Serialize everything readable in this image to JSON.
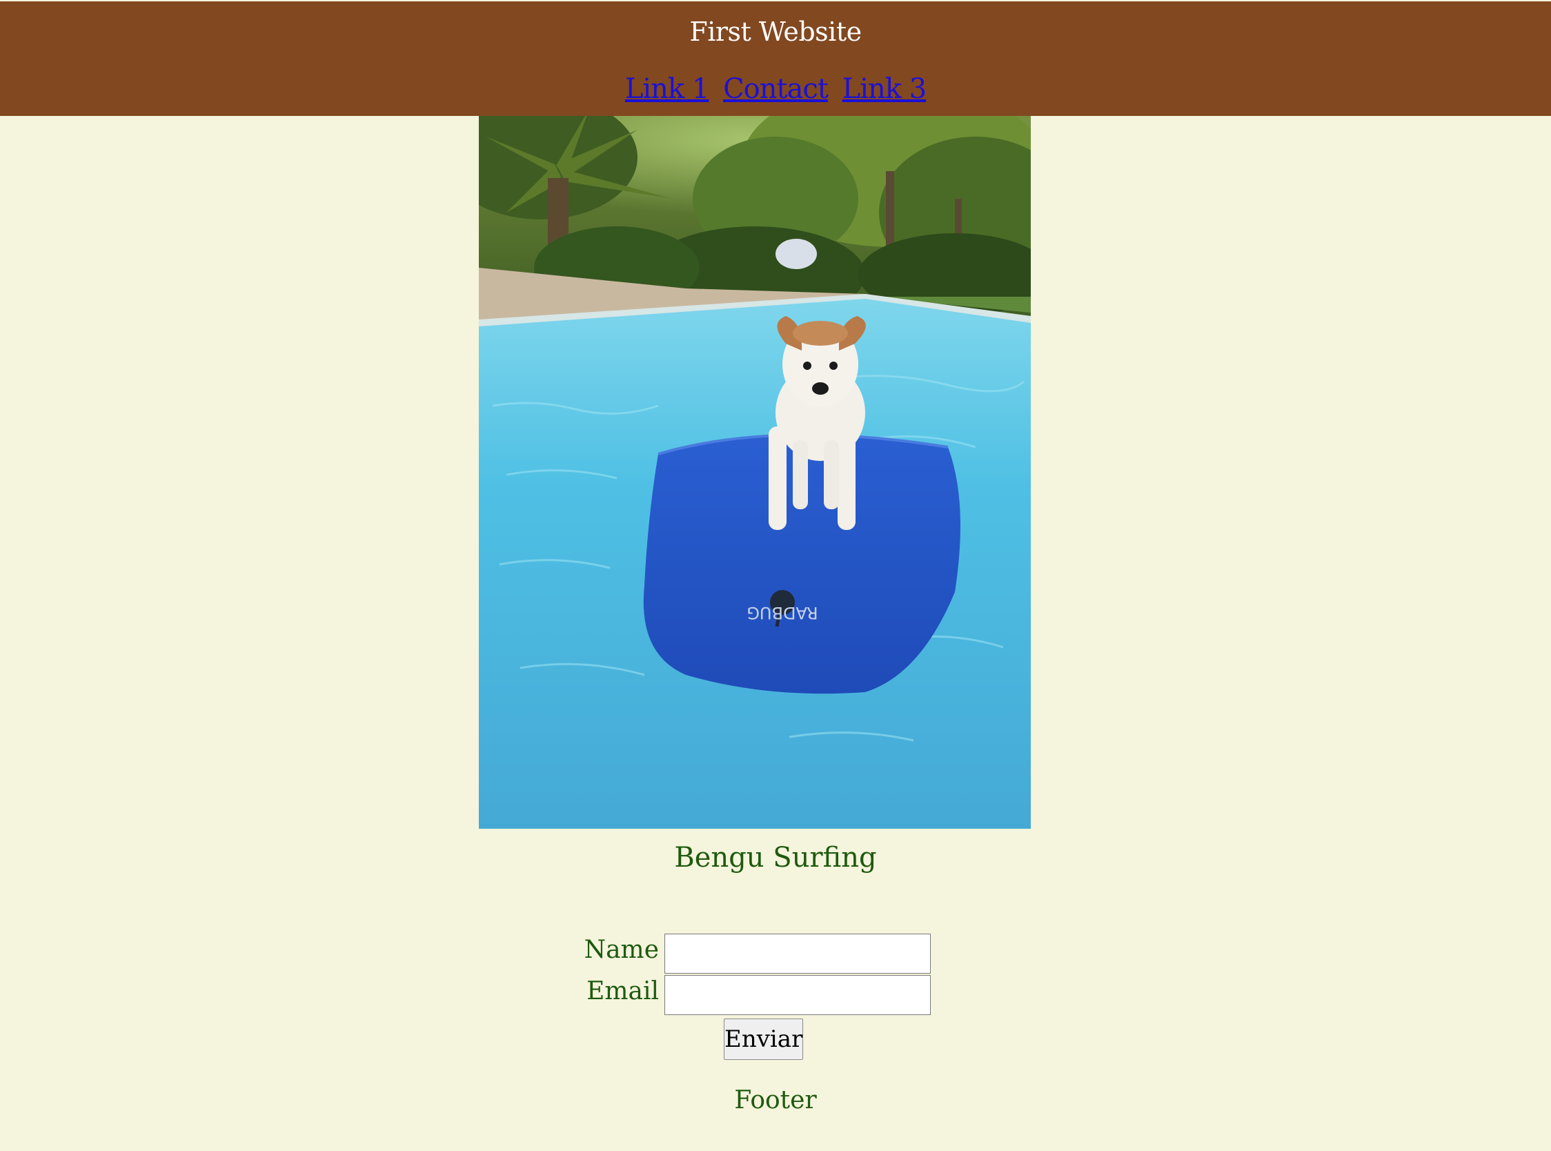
{
  "header": {
    "title": "First Website",
    "nav": [
      {
        "label": "Link 1"
      },
      {
        "label": "Contact"
      },
      {
        "label": "Link 3"
      }
    ]
  },
  "photo": {
    "caption": "Bengu Surfing",
    "board_brand": "RADBUG"
  },
  "form": {
    "name_label": "Name",
    "email_label": "Email",
    "name_value": "",
    "email_value": "",
    "submit_label": "Enviar"
  },
  "footer": {
    "text": "Footer"
  },
  "colors": {
    "header_bg": "#824820",
    "page_bg": "#f5f4dc",
    "text_green": "#1e5a0f",
    "link_blue": "#1b10d6"
  }
}
